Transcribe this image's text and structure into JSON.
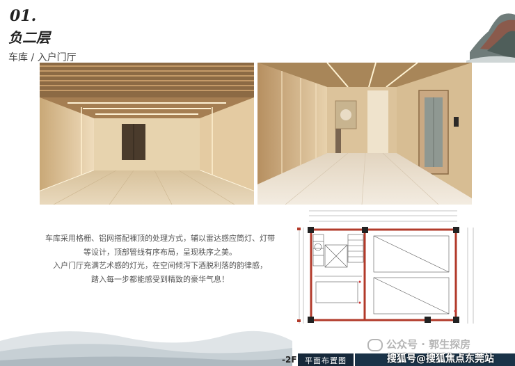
{
  "header": {
    "section_number": "01.",
    "section_title": "负二层",
    "section_subtitle": "车库 / 入户门厅"
  },
  "description": {
    "lines": [
      "车库采用格栅、铝网搭配裸顶的处理方式，辅以雷达感应筒灯、灯带",
      "等设计，顶部管线有序布局，呈现秩序之美。",
      "入户门厅充满艺术感的灯光，在空间倾泻下酒脱利落的韵律感，",
      "踏入每一步都能感受到精致的豪华气息！"
    ]
  },
  "footer": {
    "floor_label": "-2F",
    "plan_title": "平面布置图"
  },
  "watermarks": {
    "wm1": "公众号 · 郭生探房",
    "wm2": "搜狐号@搜狐焦点东莞站"
  },
  "colors": {
    "plan_wall": "#b23a2a",
    "footer_bar": "#16283a",
    "warm_wall": "#e6cfa8"
  }
}
